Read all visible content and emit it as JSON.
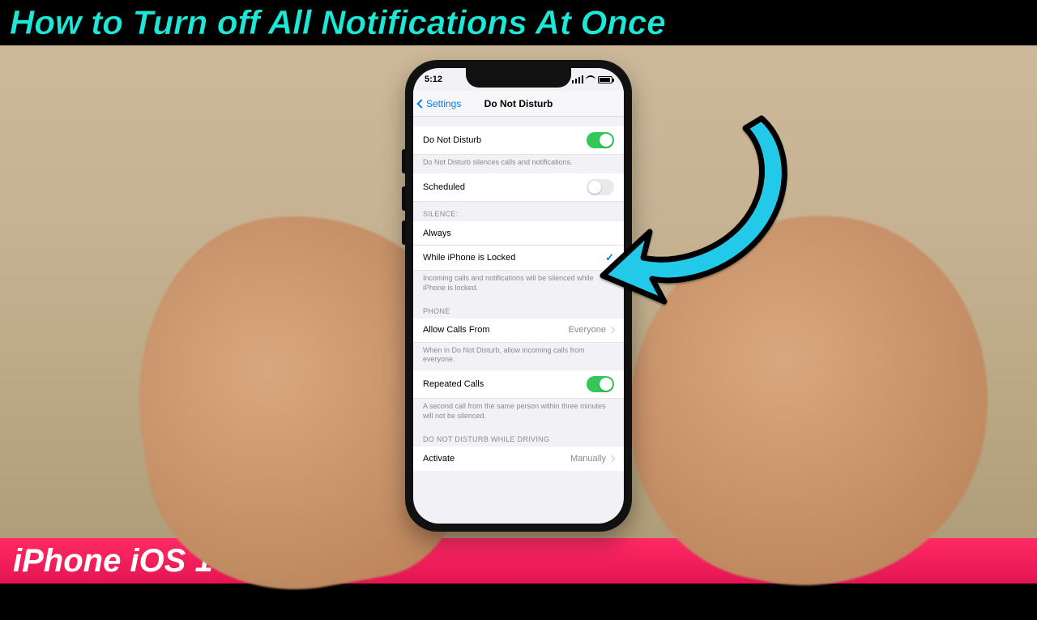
{
  "banner": {
    "title": "How to Turn off All Notifications At Once",
    "footer": "iPhone iOS 14"
  },
  "status": {
    "time": "5:12"
  },
  "nav": {
    "back": "Settings",
    "title": "Do Not Disturb"
  },
  "sections": {
    "dnd": {
      "label": "Do Not Disturb",
      "on": true,
      "footer": "Do Not Disturb silences calls and notifications."
    },
    "scheduled": {
      "label": "Scheduled",
      "on": false
    },
    "silence": {
      "header": "SILENCE:",
      "always": "Always",
      "locked": "While iPhone is Locked",
      "selected": "locked",
      "footer": "Incoming calls and notifications will be silenced while iPhone is locked."
    },
    "phone": {
      "header": "PHONE",
      "allow_label": "Allow Calls From",
      "allow_value": "Everyone",
      "allow_footer": "When in Do Not Disturb, allow incoming calls from everyone.",
      "repeated_label": "Repeated Calls",
      "repeated_on": true,
      "repeated_footer": "A second call from the same person within three minutes will not be silenced."
    },
    "driving": {
      "header": "DO NOT DISTURB WHILE DRIVING",
      "activate_label": "Activate",
      "activate_value": "Manually"
    }
  },
  "colors": {
    "accent_cyan": "#1CE8D8",
    "ios_blue": "#007aff",
    "ios_green": "#34c759",
    "footer_pink": "#ff2a63"
  }
}
